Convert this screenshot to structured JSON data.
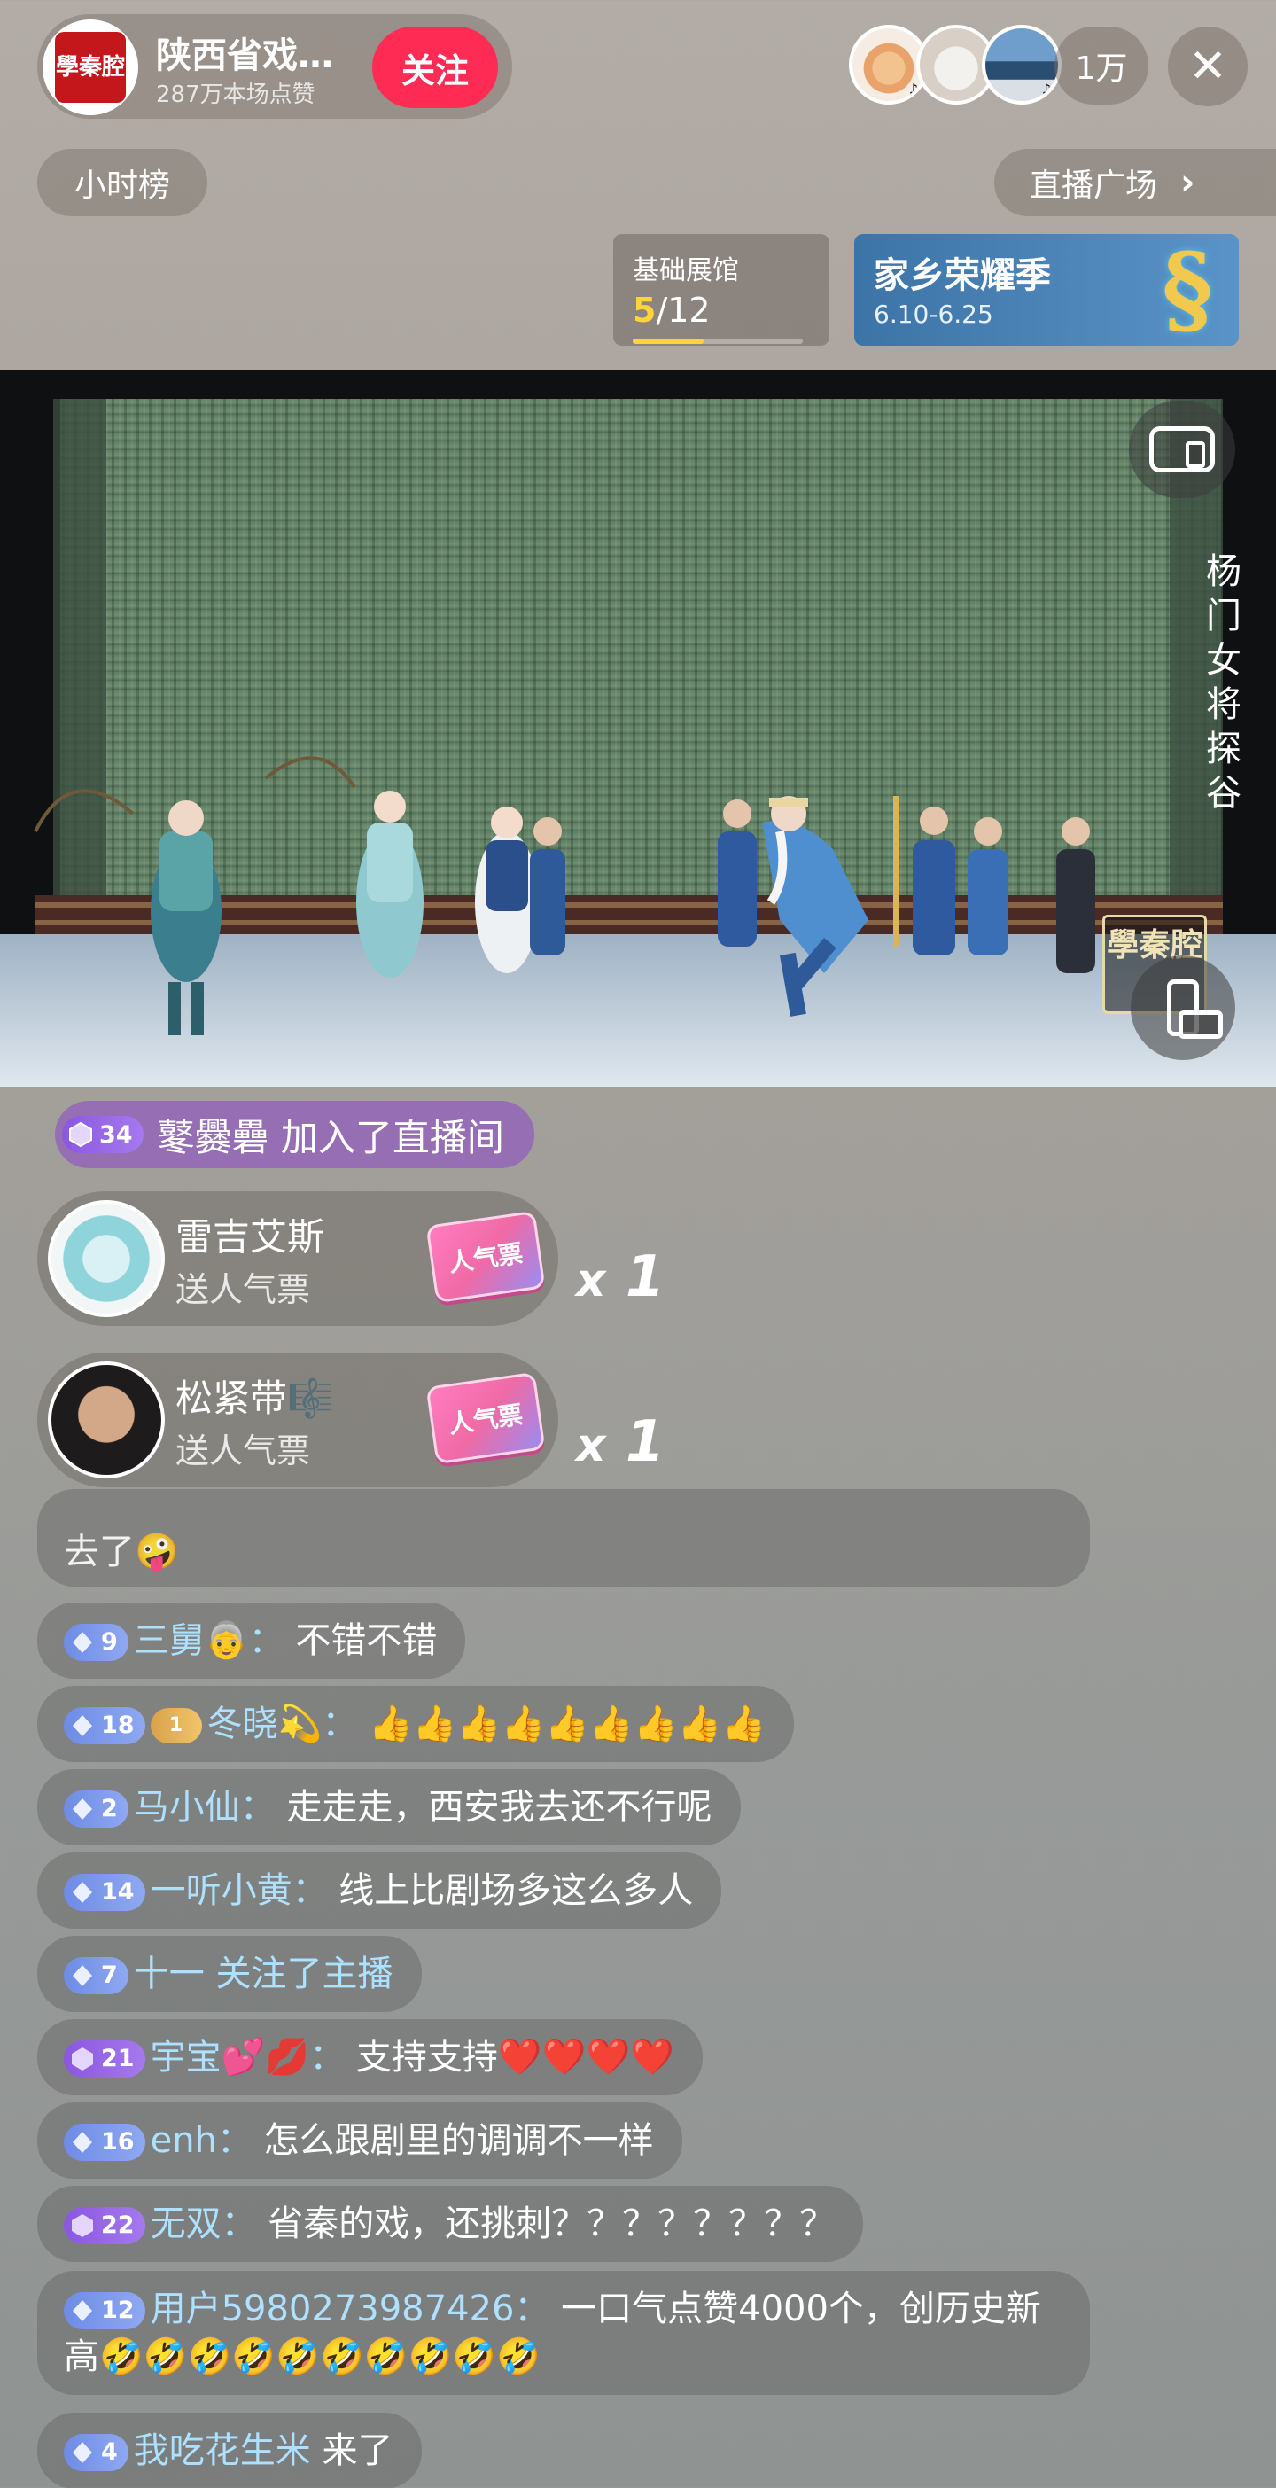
{
  "host": {
    "avatar_text": "學秦腔",
    "name": "陕西省戏…",
    "likes": "287万本场点赞",
    "follow_label": "关注"
  },
  "viewers": {
    "count": "1万",
    "close_label": "✕",
    "badge": "♪"
  },
  "nav": {
    "hour_rank": "小时榜",
    "plaza": "直播广场",
    "plaza_chevron": "›"
  },
  "hall": {
    "title": "基础展馆",
    "current": "5",
    "total": "/12",
    "progress": 0.4167
  },
  "event": {
    "title": "家乡荣耀季",
    "date": "6.10-6.25",
    "glyph": "§"
  },
  "video": {
    "caption": "杨门女将 探谷",
    "watermark": "學秦腔"
  },
  "join": {
    "level": "34",
    "text": "鼕爨礨 加入了直播间"
  },
  "gifts": [
    {
      "name": "雷吉艾斯",
      "action": "送人气票",
      "ticket": "人气票",
      "count": "1",
      "x": "x"
    },
    {
      "name": "松紧带🎼",
      "action": "送人气票",
      "ticket": "人气票",
      "count": "1",
      "x": "x"
    }
  ],
  "messages": {
    "partial": "去了🤪",
    "m1": {
      "level": "9",
      "user": "三舅👵",
      "sep": "：",
      "text": "不错不错"
    },
    "m2": {
      "level": "18",
      "fan": "1",
      "user": "冬晓💫",
      "sep": "：",
      "text": "👍👍👍👍👍👍👍👍👍"
    },
    "m3": {
      "level": "2",
      "user": "马小仙",
      "sep": "：",
      "text": "走走走，西安我去还不行呢"
    },
    "m4": {
      "level": "14",
      "user": "一听小黄",
      "sep": "：",
      "text": "线上比剧场多这么多人"
    },
    "m5": {
      "level": "7",
      "user": "十一",
      "text": " 关注了主播"
    },
    "m6": {
      "level": "21",
      "user": "宇宝💕💋",
      "sep": "：",
      "text": "支持支持❤️❤️❤️❤️"
    },
    "m7": {
      "level": "16",
      "user": "enh",
      "sep": "：",
      "text": "怎么跟剧里的调调不一样"
    },
    "m8": {
      "level": "22",
      "user": "无双",
      "sep": "：",
      "text": "省秦的戏，还挑刺？？？？？？？？"
    },
    "m9": {
      "level": "12",
      "user": "用户5980273987426",
      "sep": "：",
      "text": "一口气点赞4000个，创历史新高🤣🤣🤣🤣🤣🤣🤣🤣🤣🤣"
    },
    "m10": {
      "level": "4",
      "user": "我吃花生米",
      "text": " 来了"
    }
  },
  "colors": {
    "follow": "#fe2c55",
    "username": "#aee0ff",
    "progress": "#ffd43b",
    "level_blue": "#7e9aed",
    "level_purple": "#9766e8"
  }
}
